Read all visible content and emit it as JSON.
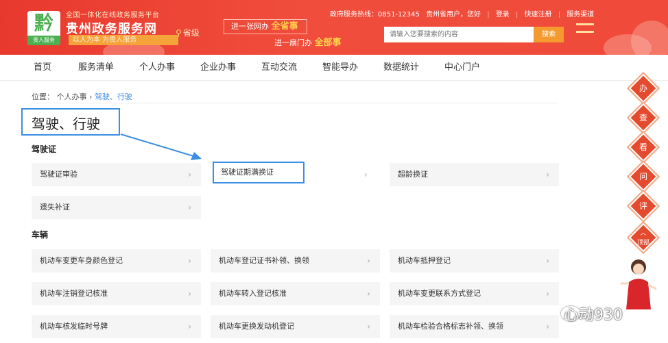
{
  "header": {
    "logo_char": "黔",
    "logo_strip": "贵人服务",
    "site_sub": "全国一体化在线政务服务平台",
    "site_title": "贵州政务服务网",
    "slogan": "以人为本  为贵人服务",
    "province": "省级",
    "promo_1_prefix": "进一张网办",
    "promo_1_highlight": "全省事",
    "promo_2_prefix": "进一扇门办",
    "promo_2_highlight": "全部事",
    "hotline": "政府服务热线：0851-12345",
    "greeting": "贵州省用户，您好",
    "login": "登录",
    "register": "快速注册",
    "channel": "服务渠道",
    "search_placeholder": "请输入您要搜索的内容",
    "search_button": "搜索"
  },
  "nav": {
    "items": [
      "首页",
      "服务清单",
      "个人办事",
      "企业办事",
      "互动交流",
      "智能导办",
      "数据统计",
      "中心门户"
    ]
  },
  "breadcrumb": {
    "prefix": "位置：",
    "level1": "个人办事",
    "separator": "›",
    "current": "驾驶、行驶"
  },
  "page_title": "驾驶、行驶",
  "sections": [
    {
      "title": "驾驶证",
      "items": [
        "驾驶证审验",
        "驾驶证期满换证",
        "超龄换证",
        "遗失补证"
      ]
    },
    {
      "title": "车辆",
      "items": [
        "机动车变更车身颜色登记",
        "机动车登记证书补领、换领",
        "机动车抵押登记",
        "机动车注销登记核准",
        "机动车转入登记核准",
        "机动车变更联系方式登记",
        "机动车核发临时号牌",
        "机动车更换发动机登记",
        "机动车检验合格标志补领、换领"
      ]
    }
  ],
  "chevron": "›",
  "side_tools": [
    "办",
    "查",
    "看",
    "问",
    "评"
  ],
  "side_top": {
    "arrow": "︿",
    "label": "顶部"
  },
  "watermark": "心动930",
  "colors": {
    "header_red": "#e8392e",
    "highlight_blue": "#3a8ee6",
    "search_orange": "#f49a2e"
  }
}
